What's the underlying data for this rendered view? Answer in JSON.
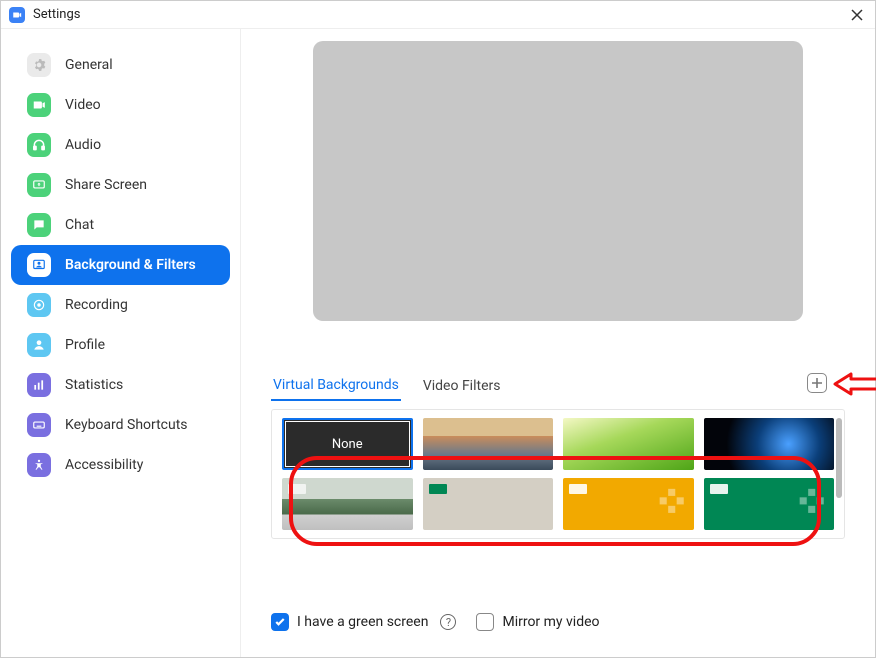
{
  "window": {
    "title": "Settings"
  },
  "sidebar": {
    "items": [
      {
        "id": "general",
        "label": "General"
      },
      {
        "id": "video",
        "label": "Video"
      },
      {
        "id": "audio",
        "label": "Audio"
      },
      {
        "id": "share-screen",
        "label": "Share Screen"
      },
      {
        "id": "chat",
        "label": "Chat"
      },
      {
        "id": "background-filters",
        "label": "Background & Filters"
      },
      {
        "id": "recording",
        "label": "Recording"
      },
      {
        "id": "profile",
        "label": "Profile"
      },
      {
        "id": "statistics",
        "label": "Statistics"
      },
      {
        "id": "keyboard-shortcuts",
        "label": "Keyboard Shortcuts"
      },
      {
        "id": "accessibility",
        "label": "Accessibility"
      }
    ]
  },
  "tabs": {
    "virtual_backgrounds": "Virtual Backgrounds",
    "video_filters": "Video Filters"
  },
  "thumbs": {
    "none_label": "None"
  },
  "footer": {
    "green_screen_label": "I have a green screen",
    "mirror_label": "Mirror my video"
  }
}
